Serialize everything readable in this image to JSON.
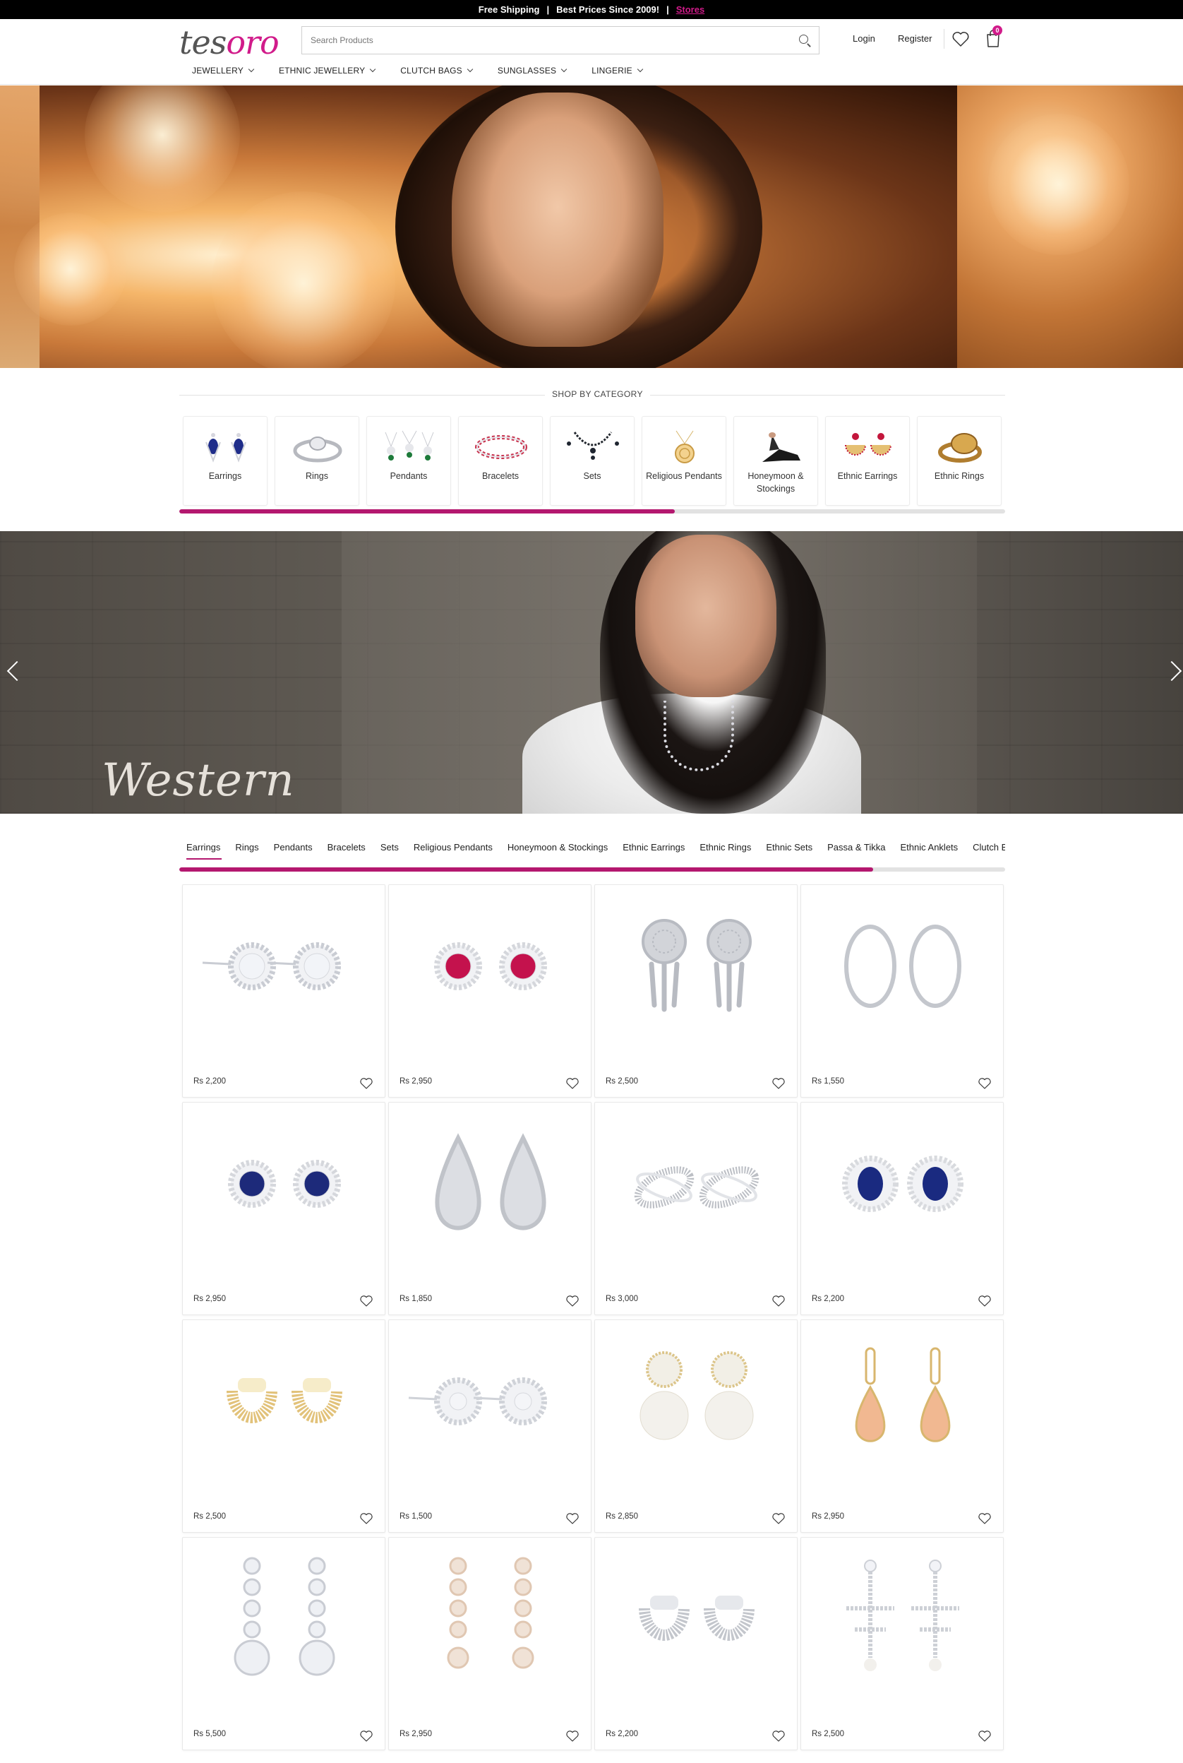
{
  "topbar": {
    "shipping": "Free Shipping",
    "sep1": "|",
    "best_prices": "Best Prices Since 2009!",
    "sep2": "|",
    "stores": "Stores"
  },
  "header": {
    "logo_part1": "tes",
    "logo_part2": "oro",
    "search_placeholder": "Search Products",
    "login": "Login",
    "register": "Register",
    "cart_count": "0"
  },
  "menu": [
    {
      "label": "JEWELLERY"
    },
    {
      "label": "ETHNIC JEWELLERY"
    },
    {
      "label": "CLUTCH BAGS"
    },
    {
      "label": "SUNGLASSES"
    },
    {
      "label": "LINGERIE"
    }
  ],
  "shop_by_category": {
    "title": "SHOP BY CATEGORY",
    "scroll_progress": 0.6,
    "items": [
      {
        "label": "Earrings",
        "icon": "earrings-icon"
      },
      {
        "label": "Rings",
        "icon": "ring-icon"
      },
      {
        "label": "Pendants",
        "icon": "pendants-icon"
      },
      {
        "label": "Bracelets",
        "icon": "bracelet-icon"
      },
      {
        "label": "Sets",
        "icon": "necklace-set-icon"
      },
      {
        "label": "Religious Pendants",
        "icon": "religious-pendant-icon"
      },
      {
        "label": "Honeymoon & Stockings",
        "icon": "stockings-icon"
      },
      {
        "label": "Ethnic Earrings",
        "icon": "ethnic-earrings-icon"
      },
      {
        "label": "Ethnic Rings",
        "icon": "ethnic-ring-icon"
      }
    ]
  },
  "banner": {
    "caption": "Western"
  },
  "tabs": {
    "scroll_progress": 0.84,
    "items": [
      {
        "label": "Earrings",
        "active": true
      },
      {
        "label": "Rings"
      },
      {
        "label": "Pendants"
      },
      {
        "label": "Bracelets"
      },
      {
        "label": "Sets"
      },
      {
        "label": "Religious Pendants"
      },
      {
        "label": "Honeymoon & Stockings"
      },
      {
        "label": "Ethnic Earrings"
      },
      {
        "label": "Ethnic Rings"
      },
      {
        "label": "Ethnic Sets"
      },
      {
        "label": "Passa & Tikka"
      },
      {
        "label": "Ethnic Anklets"
      },
      {
        "label": "Clutch Bags"
      }
    ]
  },
  "products": [
    {
      "price": "Rs 2,200",
      "style": "stud-marquise",
      "metal": "#c9ccd3",
      "stone": "#f2f4f8"
    },
    {
      "price": "Rs 2,950",
      "style": "halo-round",
      "metal": "#d5d7dc",
      "stone": "#c4124d"
    },
    {
      "price": "Rs 2,500",
      "style": "drop-disc",
      "metal": "#b8bbc2",
      "stone": "#d2d4d9"
    },
    {
      "price": "Rs 1,550",
      "style": "hoop",
      "metal": "#c4c7cd",
      "stone": "#ffffff"
    },
    {
      "price": "Rs 2,950",
      "style": "halo-round",
      "metal": "#d5d7dc",
      "stone": "#1d2a7a"
    },
    {
      "price": "Rs 1,850",
      "style": "teardrop",
      "metal": "#c0c3c9",
      "stone": "#dcdee3"
    },
    {
      "price": "Rs 3,000",
      "style": "knot",
      "metal": "#bcbfc5",
      "stone": "#e2e4e8"
    },
    {
      "price": "Rs 2,200",
      "style": "halo-oval",
      "metal": "#d8dade",
      "stone": "#1a2a80"
    },
    {
      "price": "Rs 2,500",
      "style": "huggie",
      "metal": "#e2c27a",
      "stone": "#f6ecc9"
    },
    {
      "price": "Rs 1,500",
      "style": "stud-flower",
      "metal": "#cfd2d8",
      "stone": "#f4f5f8"
    },
    {
      "price": "Rs 2,850",
      "style": "pearl-drop",
      "metal": "#dcc58a",
      "stone": "#f3f1ec"
    },
    {
      "price": "Rs 2,950",
      "style": "drop-pear",
      "metal": "#d8b66e",
      "stone": "#f1b891"
    },
    {
      "price": "Rs 5,500",
      "style": "long-drop",
      "metal": "#c9ccd3",
      "stone": "#eef0f4"
    },
    {
      "price": "Rs 2,950",
      "style": "cluster-drop",
      "metal": "#e0c7b2",
      "stone": "#f0e2d6"
    },
    {
      "price": "Rs 2,200",
      "style": "huggie",
      "metal": "#c3c6cc",
      "stone": "#e6e8ec"
    },
    {
      "price": "Rs 2,500",
      "style": "chandelier",
      "metal": "#cdd0d6",
      "stone": "#f2f3f7"
    }
  ]
}
